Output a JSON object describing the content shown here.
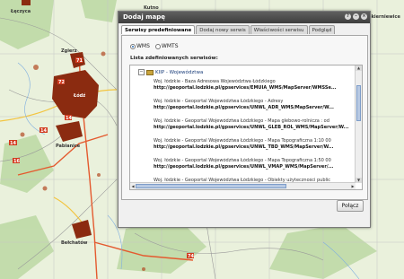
{
  "dialog": {
    "title": "Dodaj mapę",
    "tabs": [
      {
        "label": "Serwisy predefiniowane"
      },
      {
        "label": "Dodaj nowy serwis"
      },
      {
        "label": "Właściwości serwisu"
      },
      {
        "label": "Podgląd"
      }
    ],
    "radio_wms": "WMS",
    "radio_wmts": "WMTS",
    "list_label": "Lista zdefiniowanych serwisów:",
    "tree_root": "KIIP - Województwa",
    "items": [
      {
        "name": "Woj. łódzkie - Baza Adresowa Województwa Łódzkiego",
        "url": "http://geoportal.lodzkie.pl/gpservices/EMUIA_WMS/MapServer/WMSSe..."
      },
      {
        "name": "Woj. łódzkie - Geoportal Województwa Łódzkiego - Adresy",
        "url": "http://geoportal.lodzkie.pl/gpservices/UNWL_ADR_WMS/MapServer/W..."
      },
      {
        "name": "Woj. łódzkie - Geoportal Województwa Łódzkiego - Mapa glebowo-rolnicza : od",
        "url": "http://geoportal.lodzkie.pl/gpservices/UNWL_GLEB_ROL_WMS/MapServer/W..."
      },
      {
        "name": "Woj. łódzkie - Geoportal Województwa Łódzkiego - Mapa Topograficzna 1:10 00",
        "url": "http://geoportal.lodzkie.pl/gpservices/UNWL_TBD_WMS/MapServer/W..."
      },
      {
        "name": "Woj. łódzkie - Geoportal Województwa Łódzkiego - Mapa Topograficzna 1:50 00",
        "url": "http://geoportal.lodzkie.pl/gpservices/UNWL_VMAP_WMS/MapServer/..."
      },
      {
        "name": "Woj. łódzkie - Geoportal Województwa Łódzkiego - Obiekty użyteczności public",
        "url": ""
      }
    ],
    "connect_label": "Połącz"
  },
  "map": {
    "labels": [
      "Łęczyca",
      "Zgierz",
      "Łódź",
      "Pabianice",
      "Bełchatów",
      "Kutno",
      "Skierniewice"
    ],
    "road_badges": [
      "71",
      "72",
      "14",
      "14",
      "14",
      "16",
      "74"
    ],
    "accent_dialog": "#3e3e3e",
    "city_color": "#8b2b10"
  }
}
